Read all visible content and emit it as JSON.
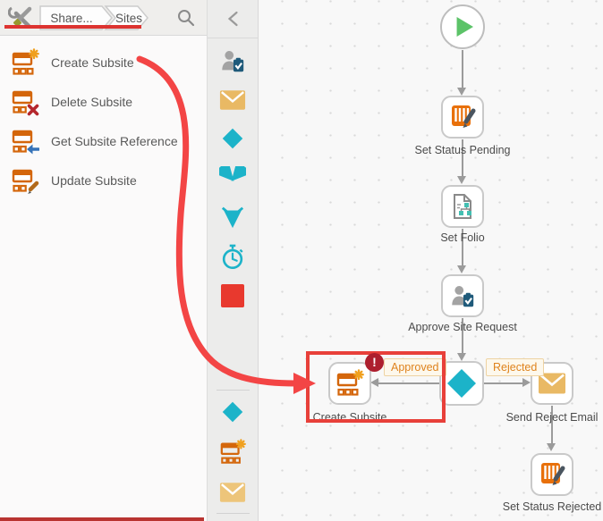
{
  "header": {
    "breadcrumb": [
      "Share...",
      "Sites"
    ],
    "icons": [
      "toolbox-icon",
      "search-icon"
    ]
  },
  "sidebar": {
    "items": [
      {
        "icon": "create-subsite-icon",
        "label": "Create Subsite"
      },
      {
        "icon": "delete-subsite-icon",
        "label": "Delete Subsite"
      },
      {
        "icon": "get-subsite-reference-icon",
        "label": "Get Subsite Reference"
      },
      {
        "icon": "update-subsite-icon",
        "label": "Update Subsite"
      }
    ]
  },
  "toolbar": {
    "top_icons": [
      "collapse-chevron-icon",
      "user-task-icon",
      "mail-icon",
      "decision-icon",
      "split-icon",
      "merge-icon",
      "timer-icon",
      "end-icon"
    ],
    "recent_icons": [
      "decision-icon",
      "create-subsite-icon",
      "mail-icon"
    ]
  },
  "workflow": {
    "nodes": [
      {
        "id": "start",
        "icon": "start-play-icon",
        "label": ""
      },
      {
        "id": "set_status_pending",
        "icon": "set-status-icon",
        "label": "Set Status Pending"
      },
      {
        "id": "set_folio",
        "icon": "folio-icon",
        "label": "Set Folio"
      },
      {
        "id": "approve_site_request",
        "icon": "user-task-icon",
        "label": "Approve Site Request"
      },
      {
        "id": "decision",
        "icon": "decision-icon",
        "label": ""
      },
      {
        "id": "create_subsite",
        "icon": "create-subsite-icon",
        "label": "Create Subsite",
        "badge": "!"
      },
      {
        "id": "send_reject_email",
        "icon": "mail-icon",
        "label": "Send Reject Email"
      },
      {
        "id": "set_status_rejected",
        "icon": "set-status-icon",
        "label": "Set Status Rejected"
      }
    ],
    "edges": [
      {
        "label": "Approved"
      },
      {
        "label": "Rejected"
      }
    ]
  },
  "colors": {
    "accent_orange": "#d4660b",
    "star_orange": "#f0a01e",
    "teal": "#1cb3c9",
    "folio_teal": "#43bfb2",
    "envelope_gold": "#e9b964",
    "clipboard_blue": "#1f5a7a",
    "person_gray": "#a3a3a3",
    "start_green": "#5cc368",
    "end_red": "#e8392e",
    "delete_red": "#b5272d",
    "reference_blue": "#3572b8",
    "edge_label_text": "#df831d",
    "annotation_red": "#e8403a",
    "error_badge_red": "#ad1f2e"
  }
}
